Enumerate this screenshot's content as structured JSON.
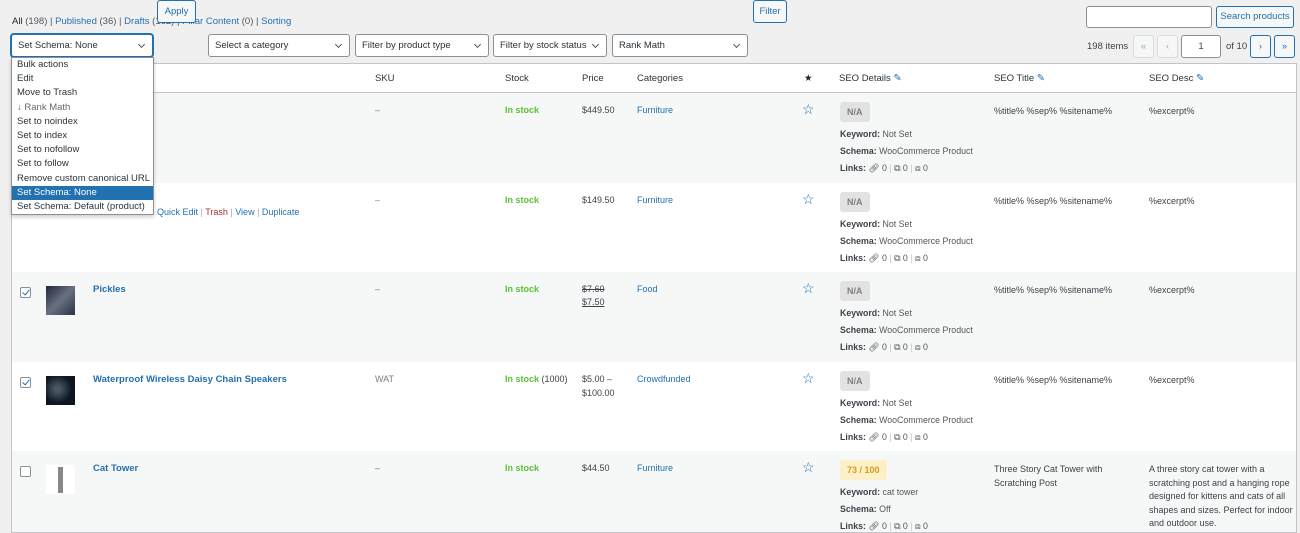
{
  "views": [
    {
      "label": "All",
      "count": "(198)"
    },
    {
      "label": "Published",
      "count": "(36)"
    },
    {
      "label": "Drafts",
      "count": "(162)"
    },
    {
      "label": "Pillar Content",
      "count": "(0)"
    },
    {
      "label": "Sorting",
      "count": ""
    }
  ],
  "toolbar": {
    "bulk_selected": "Set Schema: None",
    "apply": "Apply",
    "category": "Select a category",
    "product_type": "Filter by product type",
    "stock_status": "Filter by stock status",
    "rank_math": "Rank Math",
    "filter": "Filter",
    "search_button": "Search products",
    "search_value": ""
  },
  "pagination": {
    "items": "198 items",
    "first": "«",
    "prev": "‹",
    "page": "1",
    "of": "of 10",
    "next": "›",
    "last": "»"
  },
  "bulk_menu": [
    "Bulk actions",
    "Edit",
    "Move to Trash",
    "↓ Rank Math",
    "Set to noindex",
    "Set to index",
    "Set to nofollow",
    "Set to follow",
    "Remove custom canonical URL",
    "Set Schema: None",
    "Set Schema: Default (product)"
  ],
  "bulk_menu_selected": "Set Schema: None",
  "columns": {
    "sku": "SKU",
    "stock": "Stock",
    "price": "Price",
    "categories": "Categories",
    "featured": "★",
    "seo_details": "SEO Details",
    "seo_title": "SEO Title",
    "seo_desc": "SEO Desc"
  },
  "labels": {
    "keyword": "Keyword:",
    "schema": "Schema:",
    "links": "Links:"
  },
  "row_actions": [
    "Quick Edit",
    "Trash",
    "View",
    "Duplicate"
  ],
  "rows": [
    {
      "name": "",
      "checked": false,
      "sku": "–",
      "stock": "In stock",
      "stock_qty": "",
      "price": "$449.50",
      "price_old": "",
      "price2": "",
      "category": "Furniture",
      "score": "N/A",
      "keyword": "Not Set",
      "schema": "WooCommerce Product",
      "links": [
        "0",
        "0",
        "0"
      ],
      "seo_title": "%title% %sep% %sitename%",
      "seo_desc": "%excerpt%"
    },
    {
      "name": "",
      "checked": false,
      "sku": "–",
      "stock": "In stock",
      "stock_qty": "",
      "price": "$149.50",
      "price_old": "",
      "price2": "",
      "category": "Furniture",
      "score": "N/A",
      "keyword": "Not Set",
      "schema": "WooCommerce Product",
      "links": [
        "0",
        "0",
        "0"
      ],
      "seo_title": "%title% %sep% %sitename%",
      "seo_desc": "%excerpt%"
    },
    {
      "name": "Pickles",
      "checked": true,
      "sku": "–",
      "stock": "In stock",
      "stock_qty": "",
      "price": "",
      "price_old": "$7.60",
      "price2": "$7.50",
      "category": "Food",
      "score": "N/A",
      "keyword": "Not Set",
      "schema": "WooCommerce Product",
      "links": [
        "0",
        "0",
        "0"
      ],
      "seo_title": "%title% %sep% %sitename%",
      "seo_desc": "%excerpt%"
    },
    {
      "name": "Waterproof Wireless Daisy Chain Speakers",
      "checked": true,
      "sku": "WAT",
      "stock": "In stock",
      "stock_qty": "(1000)",
      "price": "$5.00 –",
      "price_old": "",
      "price2": "$100.00",
      "category": "Crowdfunded",
      "score": "N/A",
      "keyword": "Not Set",
      "schema": "WooCommerce Product",
      "links": [
        "0",
        "0",
        "0"
      ],
      "seo_title": "%title% %sep% %sitename%",
      "seo_desc": "%excerpt%"
    },
    {
      "name": "Cat Tower",
      "checked": false,
      "sku": "–",
      "stock": "In stock",
      "stock_qty": "",
      "price": "$44.50",
      "price_old": "",
      "price2": "",
      "category": "Furniture",
      "score": "73 / 100",
      "keyword": "cat tower",
      "schema": "Off",
      "links": [
        "0",
        "0",
        "0"
      ],
      "seo_title": "Three Story Cat Tower with Scratching Post",
      "seo_desc": "A three story cat tower with a scratching post and a hanging rope designed for kittens and cats of all shapes and sizes. Perfect for indoor and outdoor use."
    }
  ]
}
